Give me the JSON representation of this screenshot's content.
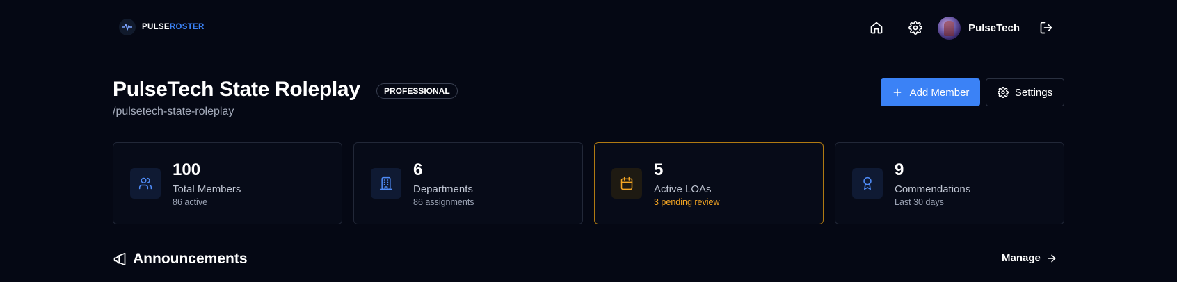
{
  "brand": {
    "name_part1": "PULSE",
    "name_part2": "ROSTER"
  },
  "nav": {
    "user_name": "PulseTech"
  },
  "header": {
    "title": "PulseTech State Roleplay",
    "badge": "PROFESSIONAL",
    "slug": "/pulsetech-state-roleplay",
    "add_member_label": "Add Member",
    "settings_label": "Settings"
  },
  "stats": [
    {
      "value": "100",
      "label": "Total Members",
      "sub": "86 active",
      "icon": "users-icon"
    },
    {
      "value": "6",
      "label": "Departments",
      "sub": "86 assignments",
      "icon": "building-icon"
    },
    {
      "value": "5",
      "label": "Active LOAs",
      "sub": "3 pending review",
      "icon": "calendar-icon"
    },
    {
      "value": "9",
      "label": "Commendations",
      "sub": "Last 30 days",
      "icon": "award-icon"
    }
  ],
  "announcements": {
    "title": "Announcements",
    "manage_label": "Manage"
  },
  "colors": {
    "background": "#050814",
    "accent": "#3b82f6",
    "warning": "#f5a623"
  }
}
